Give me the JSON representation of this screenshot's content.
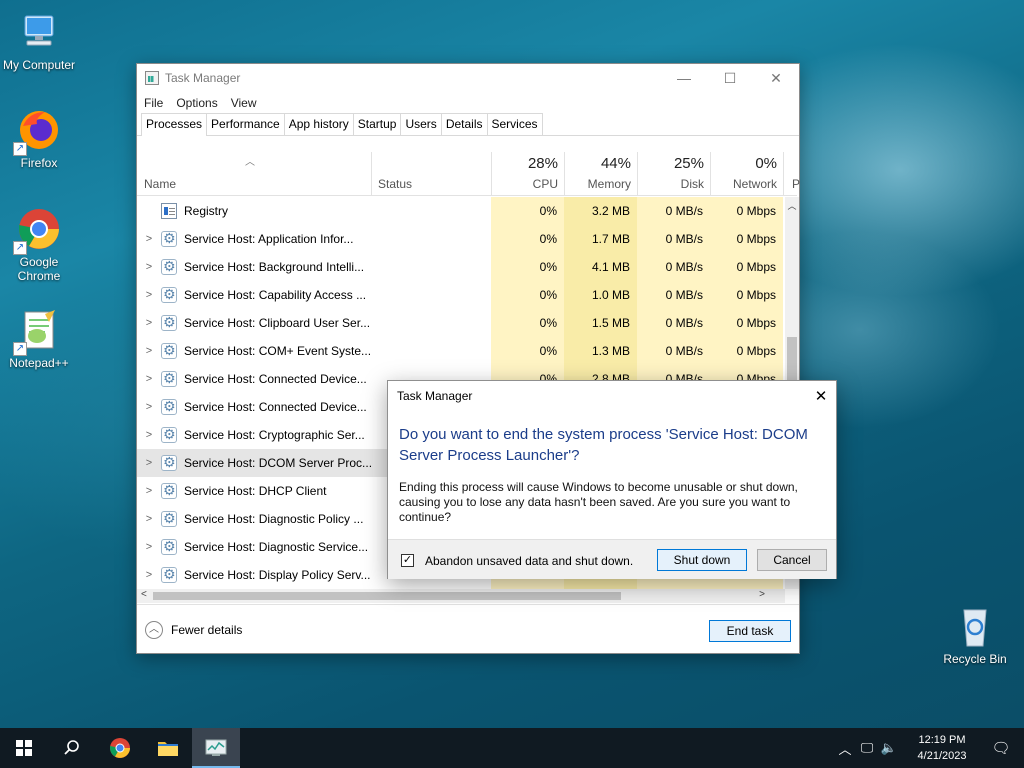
{
  "desktop": {
    "icons": [
      {
        "label": "My Computer"
      },
      {
        "label": "Firefox"
      },
      {
        "label": "Google Chrome"
      },
      {
        "label": "Notepad++"
      },
      {
        "label": "Recycle Bin"
      }
    ]
  },
  "task_manager": {
    "title": "Task Manager",
    "menu": [
      "File",
      "Options",
      "View"
    ],
    "tabs": [
      "Processes",
      "Performance",
      "App history",
      "Startup",
      "Users",
      "Details",
      "Services"
    ],
    "active_tab": "Processes",
    "columns": {
      "name": "Name",
      "status": "Status",
      "cpu": {
        "pct": "28%",
        "label": "CPU"
      },
      "memory": {
        "pct": "44%",
        "label": "Memory"
      },
      "disk": {
        "pct": "25%",
        "label": "Disk"
      },
      "network": {
        "pct": "0%",
        "label": "Network"
      },
      "power_partial": "P"
    },
    "rows": [
      {
        "name": "Registry",
        "cpu": "0%",
        "mem": "3.2 MB",
        "disk": "0 MB/s",
        "net": "0 Mbps"
      },
      {
        "name": "Service Host: Application Infor...",
        "cpu": "0%",
        "mem": "1.7 MB",
        "disk": "0 MB/s",
        "net": "0 Mbps"
      },
      {
        "name": "Service Host: Background Intelli...",
        "cpu": "0%",
        "mem": "4.1 MB",
        "disk": "0 MB/s",
        "net": "0 Mbps"
      },
      {
        "name": "Service Host: Capability Access ...",
        "cpu": "0%",
        "mem": "1.0 MB",
        "disk": "0 MB/s",
        "net": "0 Mbps"
      },
      {
        "name": "Service Host: Clipboard User Ser...",
        "cpu": "0%",
        "mem": "1.5 MB",
        "disk": "0 MB/s",
        "net": "0 Mbps"
      },
      {
        "name": "Service Host: COM+ Event Syste...",
        "cpu": "0%",
        "mem": "1.3 MB",
        "disk": "0 MB/s",
        "net": "0 Mbps"
      },
      {
        "name": "Service Host: Connected Device...",
        "cpu": "0%",
        "mem": "2.8 MB",
        "disk": "0 MB/s",
        "net": "0 Mbps"
      },
      {
        "name": "Service Host: Connected Device...",
        "cpu": "",
        "mem": "",
        "disk": "",
        "net": ""
      },
      {
        "name": "Service Host: Cryptographic Ser...",
        "cpu": "",
        "mem": "",
        "disk": "",
        "net": ""
      },
      {
        "name": "Service Host: DCOM Server Proc...",
        "cpu": "",
        "mem": "",
        "disk": "",
        "net": ""
      },
      {
        "name": "Service Host: DHCP Client",
        "cpu": "",
        "mem": "",
        "disk": "",
        "net": ""
      },
      {
        "name": "Service Host: Diagnostic Policy ...",
        "cpu": "",
        "mem": "",
        "disk": "",
        "net": ""
      },
      {
        "name": "Service Host: Diagnostic Service...",
        "cpu": "",
        "mem": "",
        "disk": "",
        "net": ""
      },
      {
        "name": "Service Host: Display Policy Serv...",
        "cpu": "",
        "mem": "",
        "disk": "",
        "net": ""
      }
    ],
    "fewer_details": "Fewer details",
    "end_task": "End task"
  },
  "dialog": {
    "title": "Task Manager",
    "heading": "Do you want to end the system process 'Service Host: DCOM Server Process Launcher'?",
    "body": "Ending this process will cause Windows to become unusable or shut down, causing you to lose any data hasn't been saved. Are you sure you want to continue?",
    "checkbox_label": "Abandon unsaved data and shut down.",
    "checkbox_checked": true,
    "shutdown_label": "Shut down",
    "cancel_label": "Cancel"
  },
  "taskbar": {
    "time": "12:19 PM",
    "date": "4/21/2023"
  }
}
